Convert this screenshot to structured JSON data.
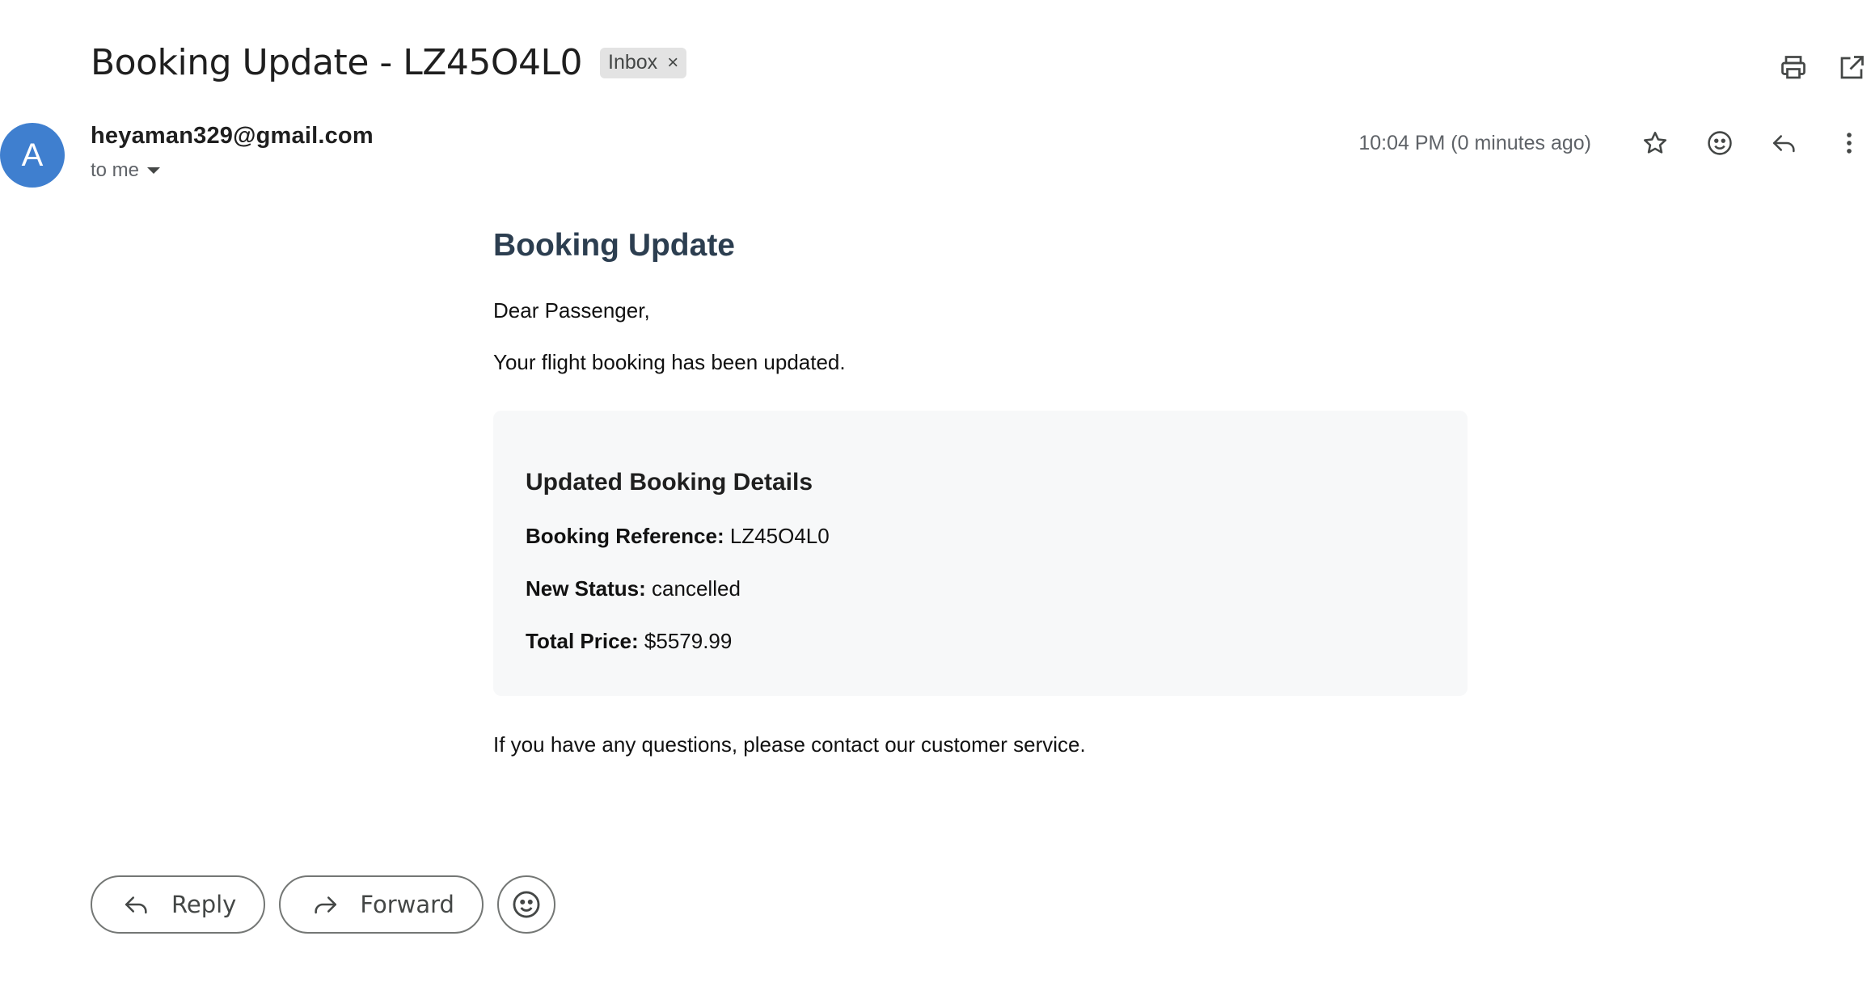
{
  "header": {
    "subject": "Booking Update - LZ45O4L0",
    "label": "Inbox",
    "label_remove": "×"
  },
  "sender": {
    "avatar_letter": "A",
    "email": "heyaman329@gmail.com",
    "recipient": "to me",
    "timestamp": "10:04 PM (0 minutes ago)"
  },
  "email": {
    "heading": "Booking Update",
    "greeting": "Dear Passenger,",
    "intro": "Your flight booking has been updated.",
    "details_title": "Updated Booking Details",
    "reference_label": "Booking Reference:",
    "reference_value": "LZ45O4L0",
    "status_label": "New Status:",
    "status_value": "cancelled",
    "price_label": "Total Price:",
    "price_value": "$5579.99",
    "footer": "If you have any questions, please contact our customer service."
  },
  "actions": {
    "reply_label": "Reply",
    "forward_label": "Forward"
  },
  "icons": [
    "print-icon",
    "open-in-new-window-icon",
    "star-icon",
    "emoji-icon",
    "reply-icon",
    "more-vert-icon",
    "forward-icon",
    "caret-down-icon",
    "close-icon"
  ],
  "colors": {
    "avatar": "#3f7fcf",
    "heading": "#2c3e50",
    "details_background": "#f7f8f9",
    "chip_background": "#e3e3e3"
  }
}
